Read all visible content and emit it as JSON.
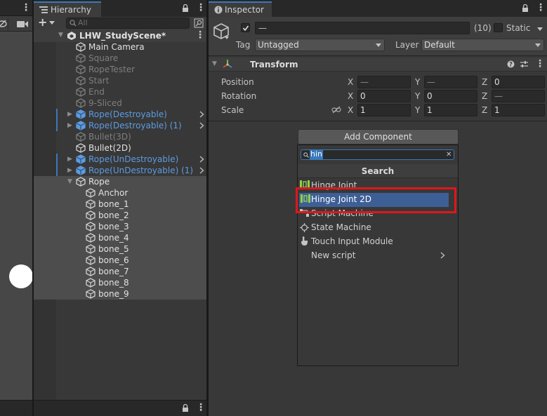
{
  "scene": {
    "toolbar_icons": [
      "eye-slash-icon",
      "camera-icon"
    ]
  },
  "hierarchy": {
    "tab_label": "Hierarchy",
    "search_placeholder": "All",
    "add_symbol": "+",
    "scene_name": "LHW_StudyScene*",
    "items": [
      {
        "label": "Main Camera",
        "state": "white"
      },
      {
        "label": "Square",
        "state": "gray"
      },
      {
        "label": "RopeTester",
        "state": "gray"
      },
      {
        "label": "Start",
        "state": "gray"
      },
      {
        "label": "End",
        "state": "gray"
      },
      {
        "label": "9-Sliced",
        "state": "gray"
      },
      {
        "label": "Rope(Destroyable)",
        "state": "blue"
      },
      {
        "label": "Rope(Destroyable) (1)",
        "state": "blue"
      },
      {
        "label": "Bullet(3D)",
        "state": "gray"
      },
      {
        "label": "Bullet(2D)",
        "state": "white"
      },
      {
        "label": "Rope(UnDestroyable)",
        "state": "blue"
      },
      {
        "label": "Rope(UnDestroyable) (1)",
        "state": "blue"
      },
      {
        "label": "Rope",
        "state": "white"
      },
      {
        "label": "Anchor",
        "state": "white"
      },
      {
        "label": "bone_1",
        "state": "white"
      },
      {
        "label": "bone_2",
        "state": "white"
      },
      {
        "label": "bone_3",
        "state": "white"
      },
      {
        "label": "bone_4",
        "state": "white"
      },
      {
        "label": "bone_5",
        "state": "white"
      },
      {
        "label": "bone_6",
        "state": "white"
      },
      {
        "label": "bone_7",
        "state": "white"
      },
      {
        "label": "bone_8",
        "state": "white"
      },
      {
        "label": "bone_9",
        "state": "white"
      }
    ]
  },
  "inspector": {
    "tab_label": "Inspector",
    "object_name": "—",
    "count": "(10)",
    "static_label": "Static",
    "tag_label": "Tag",
    "tag_value": "Untagged",
    "layer_label": "Layer",
    "layer_value": "Default",
    "transform": {
      "title": "Transform",
      "position_label": "Position",
      "rotation_label": "Rotation",
      "scale_label": "Scale",
      "axis_x": "X",
      "axis_y": "Y",
      "axis_z": "Z",
      "position": {
        "x": "—",
        "y": "—",
        "z": "0"
      },
      "rotation": {
        "x": "0",
        "y": "0",
        "z": "—"
      },
      "scale": {
        "x": "1",
        "y": "1",
        "z": "1"
      }
    },
    "add_component": {
      "button_label": "Add Component",
      "search_value": "hin",
      "section_title": "Search",
      "items": [
        {
          "label": "Hinge Joint",
          "icon": "hinge-joint-icon"
        },
        {
          "label": "Hinge Joint 2D",
          "icon": "hinge-joint-2d-icon"
        },
        {
          "label": "Script Machine",
          "icon": "script-machine-icon"
        },
        {
          "label": "State Machine",
          "icon": "state-machine-icon"
        },
        {
          "label": "Touch Input Module",
          "icon": "touch-input-icon"
        },
        {
          "label": "New script",
          "icon": ""
        }
      ]
    }
  },
  "colors": {
    "selection": "#3e5f96",
    "highlight_box": "#e0161a",
    "prefab_blue": "#5d9be0",
    "accent": "#3a79bb"
  }
}
